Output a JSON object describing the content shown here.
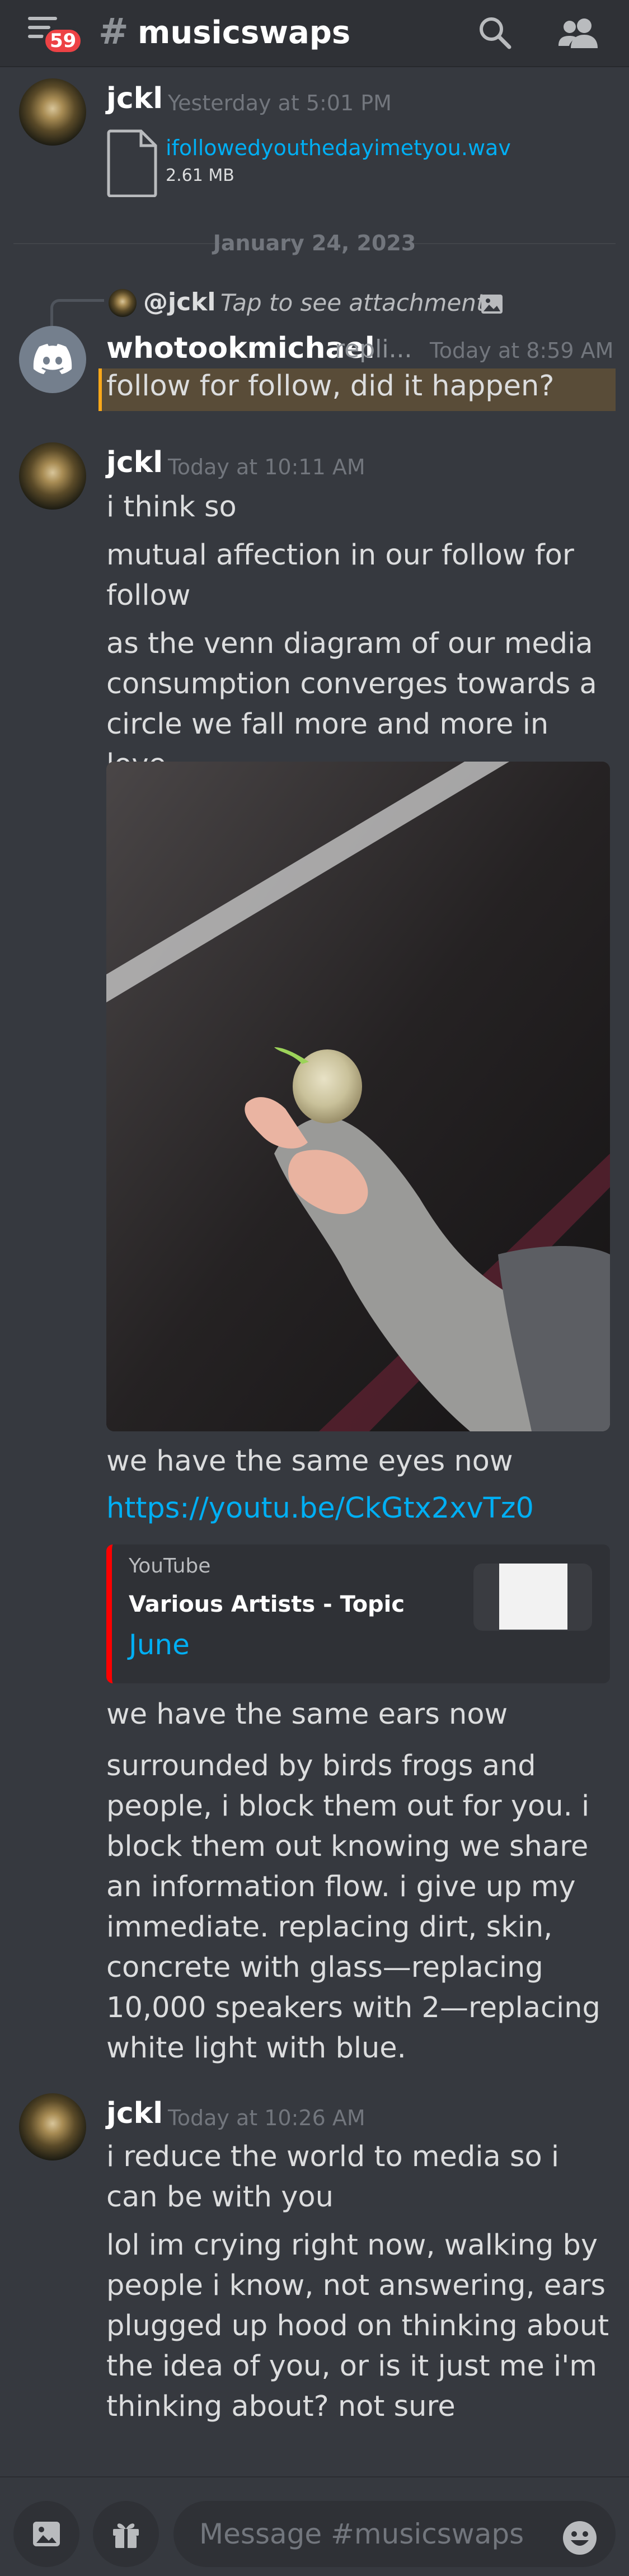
{
  "header": {
    "notification_count": "59",
    "hash": "#",
    "channel_name": "musicswaps",
    "icons": [
      "hamburger-icon",
      "search-icon",
      "members-icon"
    ]
  },
  "messages": [
    {
      "username": "jckl",
      "timestamp": "Yesterday at 5:01 PM",
      "attachment": {
        "file_name": "ifollowedyouthedayimetyou.wav",
        "file_size": "2.61 MB"
      }
    }
  ],
  "date_divider": "January 24, 2023",
  "reply": {
    "replied_user": "@jckl",
    "replied_text": "Tap to see attachment",
    "username": "whotookmichael",
    "username_suffix": "repli...",
    "timestamp": "Today at 8:59 AM",
    "text": "follow for follow, did it happen?"
  },
  "group2": {
    "username": "jckl",
    "timestamp": "Today at 10:11 AM",
    "lines": [
      "i think so",
      "mutual affection in our follow for follow",
      "as the venn diagram of our media consumption converges towards a circle we fall more and more in love"
    ],
    "after_image": "we have the same eyes now",
    "link": "https://youtu.be/CkGtx2xvTz0",
    "embed": {
      "provider": "YouTube",
      "author": "Various Artists - Topic",
      "title": "June"
    },
    "after_embed": [
      "we have the same ears now",
      "surrounded by birds frogs and people, i block them out for you. i block them out knowing we share an information flow. i give up my immediate. replacing dirt, skin, concrete with glass—replacing 10,000 speakers with 2—replacing white light with blue."
    ]
  },
  "group3": {
    "username": "jckl",
    "timestamp": "Today at 10:26 AM",
    "lines": [
      "i reduce the world to media so i can be with you",
      "lol im crying right now,  walking by people i know, not answering, ears plugged up hood on thinking about the idea of you, or is it just me i'm thinking about? not sure"
    ]
  },
  "input": {
    "placeholder": "Message #musicswaps"
  },
  "colors": {
    "background": "#36393f",
    "header": "#2f3136",
    "link": "#00aff4",
    "badge": "#ed4245",
    "mention_highlight": "#faa81a",
    "youtube_red": "#ff0000"
  }
}
